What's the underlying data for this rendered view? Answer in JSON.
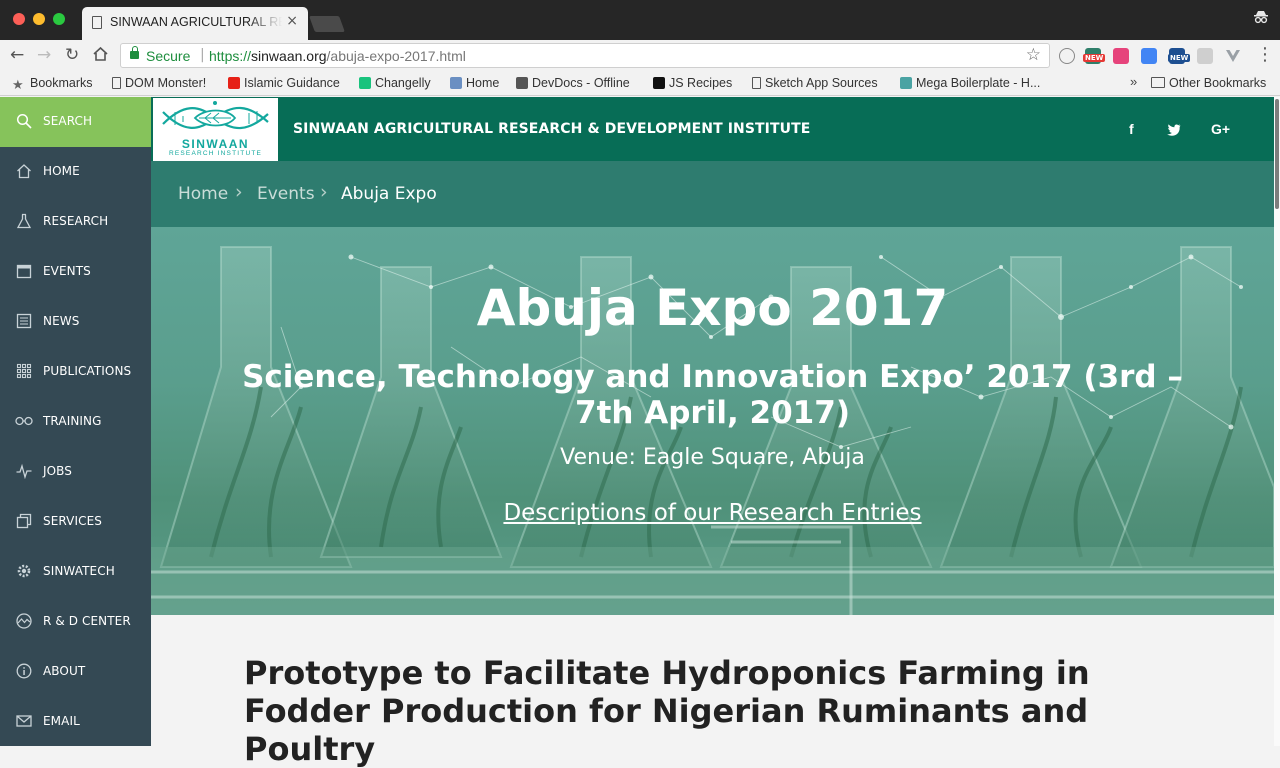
{
  "browser": {
    "tab_title": "SINWAAN AGRICULTURAL RESEARCH & DEVELOPMENT INSTITUTE",
    "tab_close": "×",
    "secure_label": "Secure",
    "url_scheme": "https://",
    "url_host": "sinwaan.org",
    "url_path": "/abuja-expo-2017.html",
    "ext_badge": "NEW",
    "bookmarks": [
      {
        "label": "Bookmarks",
        "icon": "star-icon"
      },
      {
        "label": "DOM Monster!",
        "icon": "document-icon"
      },
      {
        "label": "Islamic Guidance",
        "icon": "youtube-icon"
      },
      {
        "label": "Changelly",
        "icon": "changelly-icon"
      },
      {
        "label": "Home",
        "icon": "flow-icon"
      },
      {
        "label": "DevDocs - Offline",
        "icon": "devdocs-icon"
      },
      {
        "label": "JS Recipes",
        "icon": "terminal-icon"
      },
      {
        "label": "Sketch App Sources",
        "icon": "document-icon"
      },
      {
        "label": "Mega Boilerplate - H...",
        "icon": "stack-icon"
      }
    ],
    "more_bookmarks": "»",
    "other_bookmarks": "Other Bookmarks"
  },
  "sidebar": {
    "items": [
      {
        "label": "SEARCH",
        "icon": "search-icon",
        "active": true
      },
      {
        "label": "HOME",
        "icon": "home-icon"
      },
      {
        "label": "RESEARCH",
        "icon": "flask-icon"
      },
      {
        "label": "EVENTS",
        "icon": "calendar-icon"
      },
      {
        "label": "NEWS",
        "icon": "newspaper-icon"
      },
      {
        "label": "PUBLICATIONS",
        "icon": "grid-icon"
      },
      {
        "label": "TRAINING",
        "icon": "glasses-icon"
      },
      {
        "label": "JOBS",
        "icon": "pulse-icon"
      },
      {
        "label": "SERVICES",
        "icon": "copy-icon"
      },
      {
        "label": "SINWATECH",
        "icon": "gear-icon"
      },
      {
        "label": "R & D CENTER",
        "icon": "chart-icon"
      },
      {
        "label": "ABOUT",
        "icon": "info-icon"
      },
      {
        "label": "EMAIL",
        "icon": "mail-icon"
      }
    ]
  },
  "header": {
    "logo_text": "SINWAAN",
    "logo_sub": "RESEARCH INSTITUTE",
    "site_title": "SINWAAN AGRICULTURAL RESEARCH & DEVELOPMENT INSTITUTE",
    "social": {
      "facebook": "f",
      "twitter": "twitter-icon",
      "google_plus": "G+"
    }
  },
  "breadcrumb": {
    "home": "Home",
    "events": "Events",
    "current": "Abuja Expo",
    "separator": "›"
  },
  "hero": {
    "title": "Abuja Expo 2017",
    "subtitle": "Science, Technology and Innovation Expo’ 2017 (3rd – 7th April, 2017)",
    "venue": "Venue: Eagle Square, Abuja",
    "link": "Descriptions of our Research Entries"
  },
  "content": {
    "heading": "Prototype to Facilitate Hydroponics Farming in Fodder Production for Nigerian Ruminants and Poultry"
  },
  "colors": {
    "header": "#076d56",
    "breadcrumb": "#2e7c6f",
    "sidebar": "#344954",
    "active": "#86c35b"
  }
}
